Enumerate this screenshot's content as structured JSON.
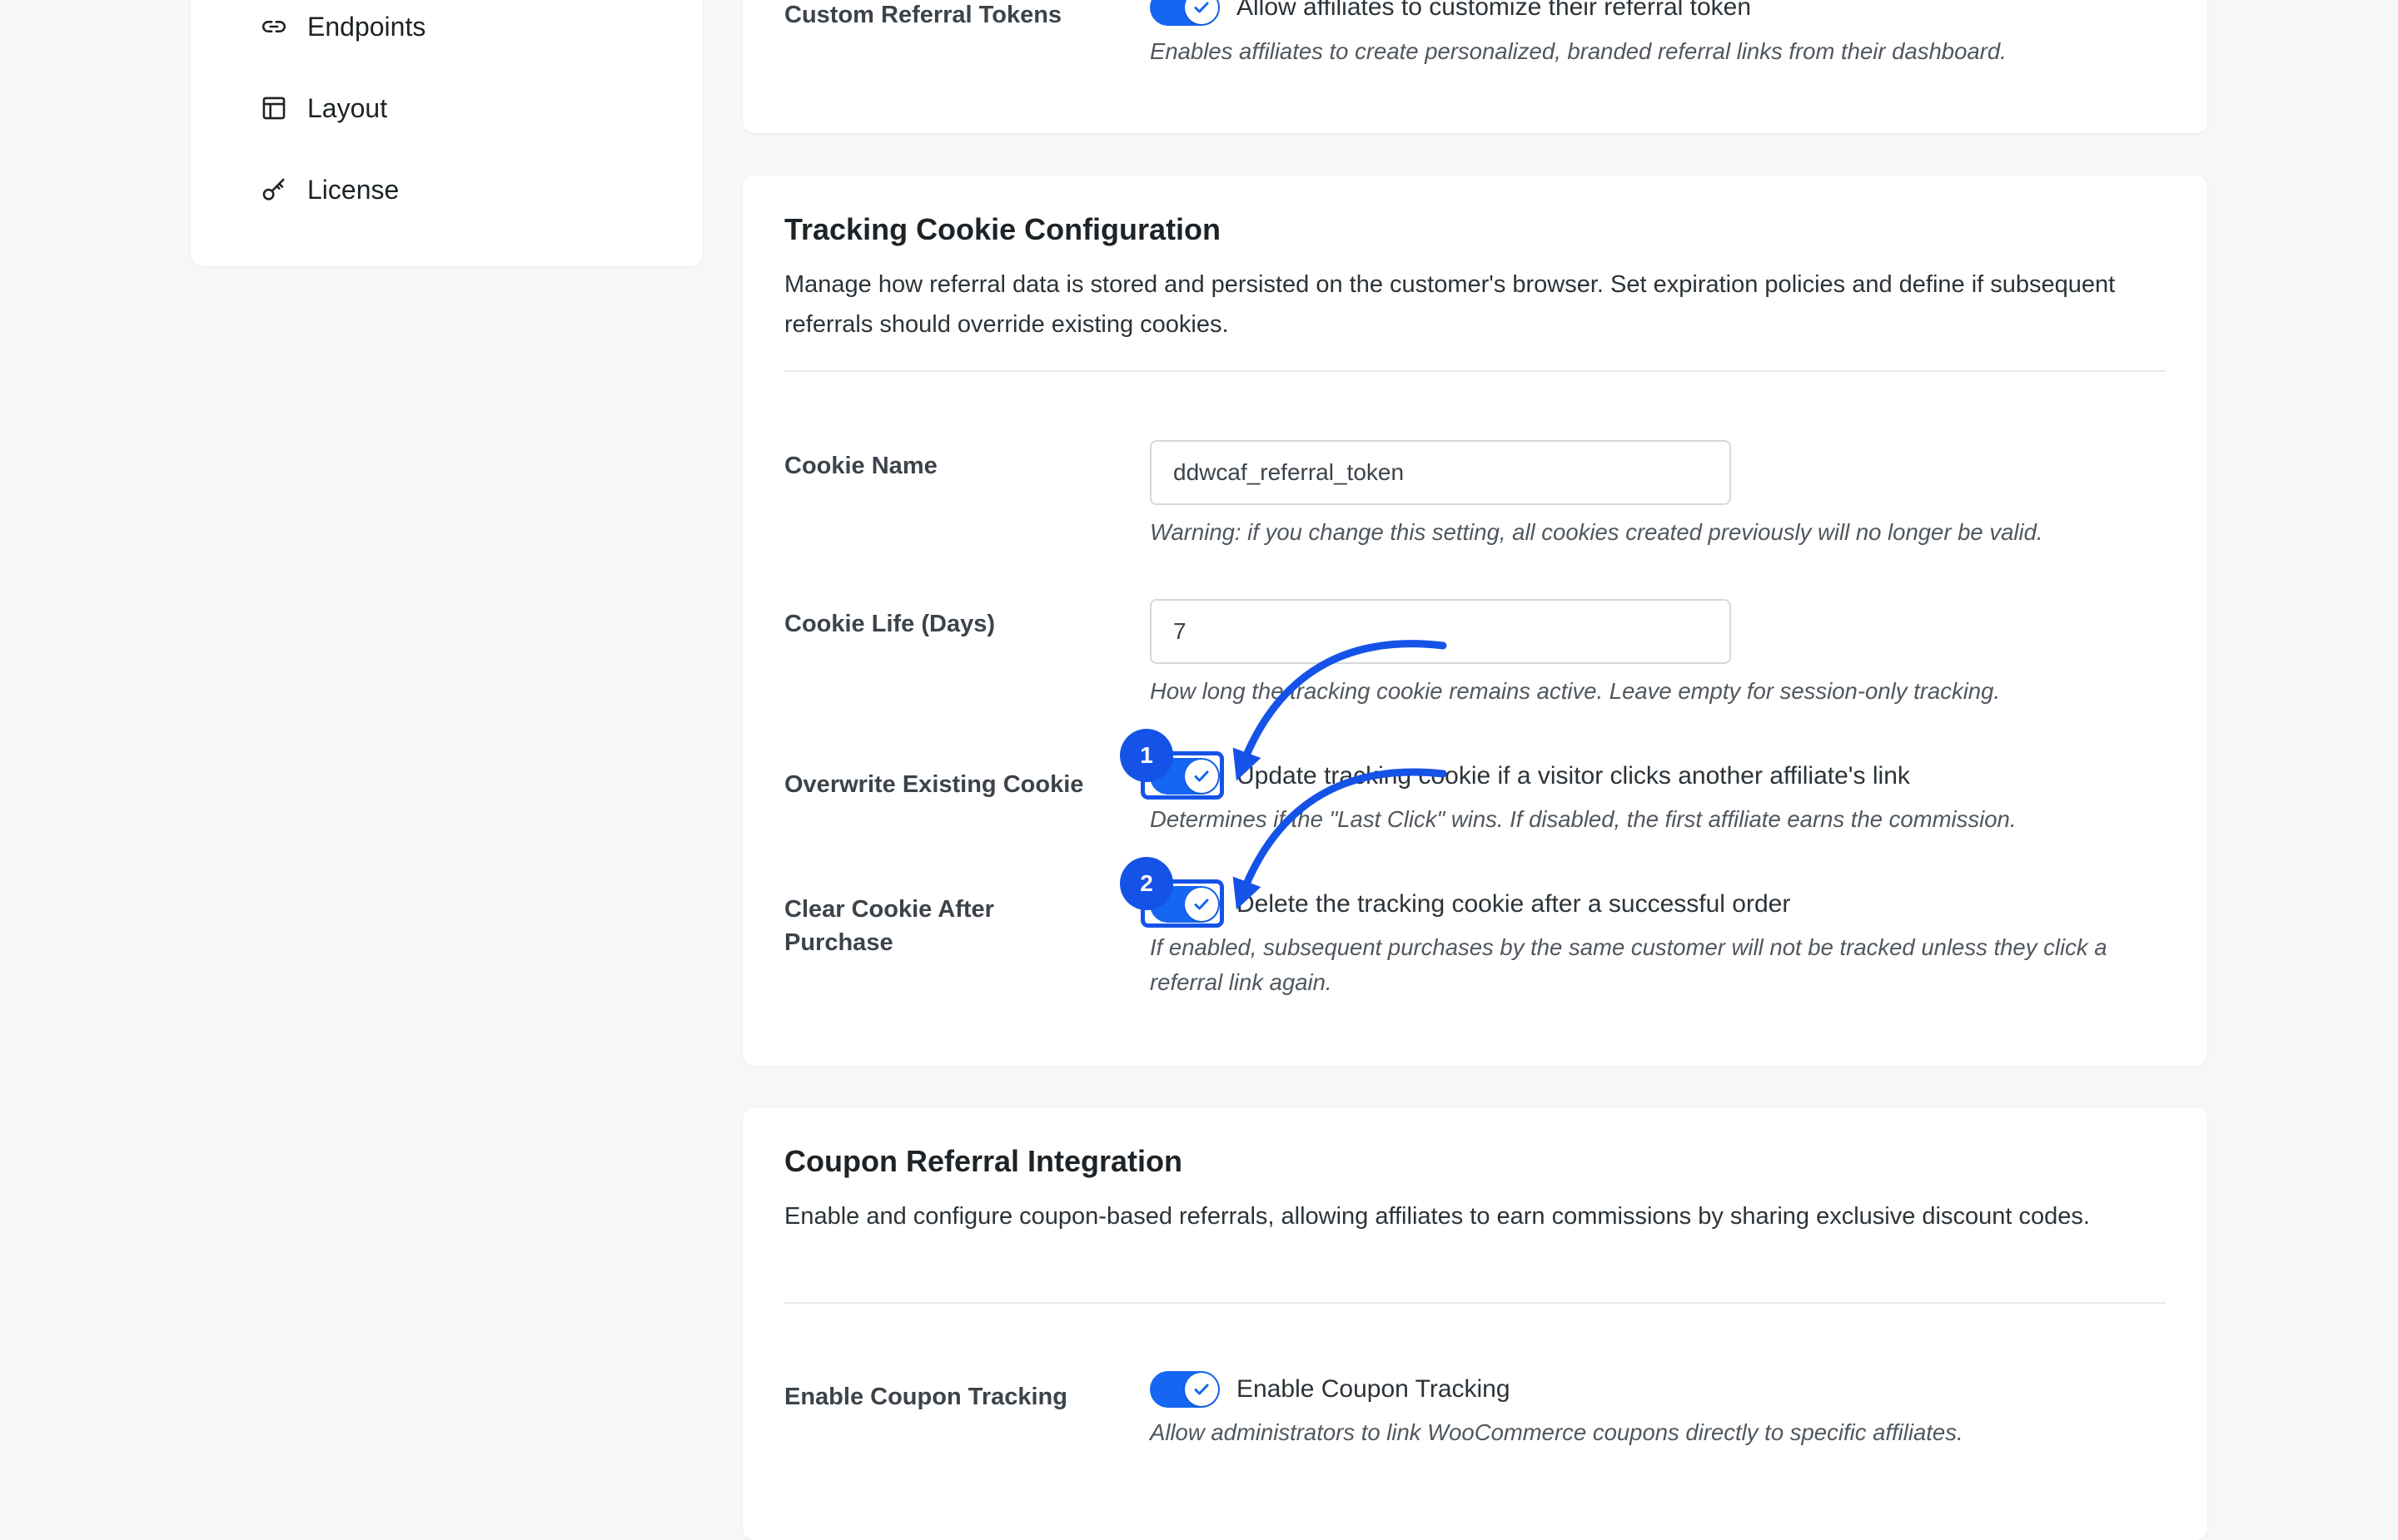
{
  "sidebar": {
    "items": [
      {
        "label": "Endpoints",
        "icon": "link-icon"
      },
      {
        "label": "Layout",
        "icon": "layout-icon"
      },
      {
        "label": "License",
        "icon": "key-icon"
      }
    ]
  },
  "referral_tokens": {
    "label": "Custom Referral Tokens",
    "toggle_label": "Allow affiliates to customize their referral token",
    "help": "Enables affiliates to create personalized, branded referral links from their dashboard.",
    "enabled": true
  },
  "tracking": {
    "title": "Tracking Cookie Configuration",
    "description": "Manage how referral data is stored and persisted on the customer's browser. Set expiration policies and define if subsequent referrals should override existing cookies.",
    "cookie_name": {
      "label": "Cookie Name",
      "value": "ddwcaf_referral_token",
      "help": "Warning: if you change this setting, all cookies created previously will no longer be valid."
    },
    "cookie_life": {
      "label": "Cookie Life (Days)",
      "value": "7",
      "help": "How long the tracking cookie remains active. Leave empty for session-only tracking."
    },
    "overwrite": {
      "label": "Overwrite Existing Cookie",
      "toggle_label": "Update tracking cookie if a visitor clicks another affiliate's link",
      "help": "Determines if the \"Last Click\" wins. If disabled, the first affiliate earns the commission.",
      "enabled": true,
      "marker": "1"
    },
    "clear_after": {
      "label": "Clear Cookie After Purchase",
      "toggle_label": "Delete the tracking cookie after a successful order",
      "help": "If enabled, subsequent purchases by the same customer will not be tracked unless they click a referral link again.",
      "enabled": true,
      "marker": "2"
    }
  },
  "coupon": {
    "title": "Coupon Referral Integration",
    "description": "Enable and configure coupon-based referrals, allowing affiliates to earn commissions by sharing exclusive discount codes.",
    "enable": {
      "label": "Enable Coupon Tracking",
      "toggle_label": "Enable Coupon Tracking",
      "help": "Allow administrators to link WooCommerce coupons directly to specific affiliates.",
      "enabled": true
    }
  },
  "colors": {
    "accent": "#1566f3",
    "annotation": "#1553e8",
    "background": "#f6f7f9"
  }
}
